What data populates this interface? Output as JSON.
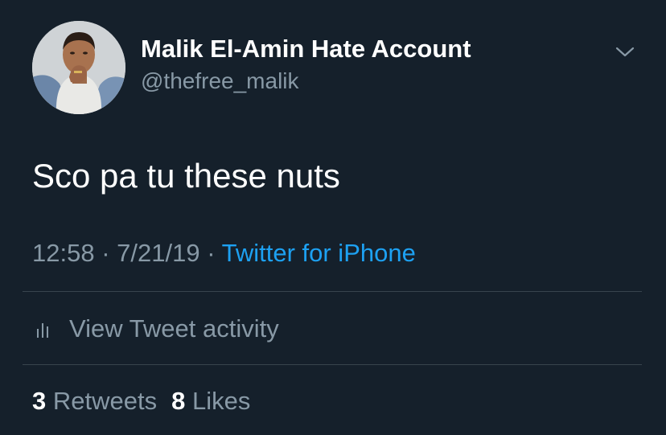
{
  "tweet": {
    "author": {
      "display_name": "Malik El-Amin Hate Account",
      "handle": "@thefree_malik"
    },
    "text": "Sco pa tu these nuts",
    "time": "12:58",
    "date": "7/21/19",
    "separator": "·",
    "source": "Twitter for iPhone",
    "activity_label": "View Tweet activity",
    "stats": {
      "retweets_count": "3",
      "retweets_label": "Retweets",
      "likes_count": "8",
      "likes_label": "Likes"
    }
  },
  "icons": {
    "menu": "chevron-down-icon",
    "activity": "bar-chart-icon",
    "avatar": "profile-photo"
  },
  "colors": {
    "background": "#15202b",
    "primary_text": "#ffffff",
    "secondary_text": "#8899a6",
    "link": "#1da1f2",
    "divider": "#38444d"
  }
}
